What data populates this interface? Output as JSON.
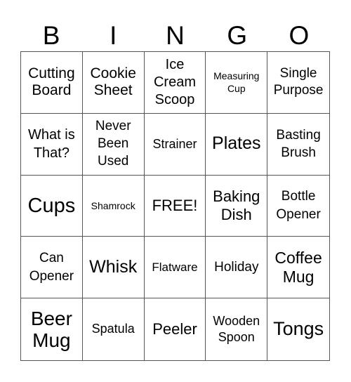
{
  "header": [
    "B",
    "I",
    "N",
    "G",
    "O"
  ],
  "cells": [
    "Cutting Board",
    "Cookie Sheet",
    "Ice Cream Scoop",
    "Measuring Cup",
    "Single Purpose",
    "What is That?",
    "Never Been Used",
    "Strainer",
    "Plates",
    "Basting Brush",
    "Cups",
    "Shamrock",
    "FREE!",
    "Baking Dish",
    "Bottle Opener",
    "Can Opener",
    "Whisk",
    "Flatware",
    "Holiday",
    "Coffee Mug",
    "Beer Mug",
    "Spatula",
    "Peeler",
    "Wooden Spoon",
    "Tongs"
  ]
}
